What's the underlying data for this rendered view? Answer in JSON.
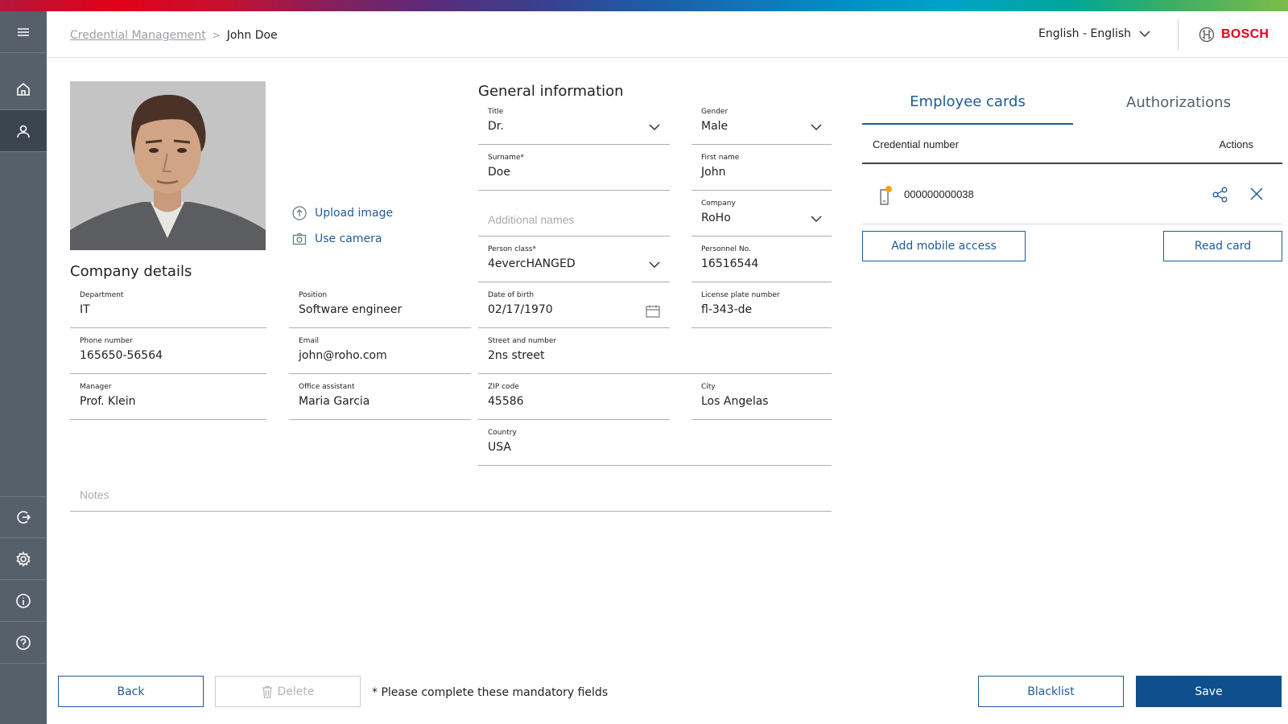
{
  "breadcrumb": {
    "parent": "Credential Management",
    "separator": ">",
    "current": "John Doe"
  },
  "header": {
    "language": "English - English",
    "brand": "BOSCH"
  },
  "photo_actions": {
    "upload": "Upload image",
    "camera": "Use camera"
  },
  "general": {
    "title": "General information",
    "fields": {
      "title": {
        "label": "Title",
        "value": "Dr."
      },
      "gender": {
        "label": "Gender",
        "value": "Male"
      },
      "surname": {
        "label": "Surname*",
        "value": "Doe"
      },
      "first_name": {
        "label": "First name",
        "value": "John"
      },
      "additional_names": {
        "placeholder": "Additional names"
      },
      "company": {
        "label": "Company",
        "value": "RoHo"
      },
      "person_class": {
        "label": "Person class*",
        "value": "4evercHANGED"
      },
      "personnel_no": {
        "label": "Personnel No.",
        "value": "16516544"
      },
      "dob": {
        "label": "Date of birth",
        "value": "02/17/1970"
      },
      "license_plate": {
        "label": "License plate number",
        "value": "fl-343-de"
      },
      "street": {
        "label": "Street and number",
        "value": "2ns street"
      },
      "zip": {
        "label": "ZIP code",
        "value": "45586"
      },
      "city": {
        "label": "City",
        "value": "Los Angelas"
      },
      "country": {
        "label": "Country",
        "value": "USA"
      }
    }
  },
  "company": {
    "title": "Company details",
    "fields": {
      "department": {
        "label": "Department",
        "value": "IT"
      },
      "position": {
        "label": "Position",
        "value": "Software engineer"
      },
      "phone": {
        "label": "Phone number",
        "value": "165650-56564"
      },
      "email": {
        "label": "Email",
        "value": "john@roho.com"
      },
      "manager": {
        "label": "Manager",
        "value": "Prof. Klein"
      },
      "office_assistant": {
        "label": "Office assistant",
        "value": "Maria Garcia"
      }
    }
  },
  "notes": {
    "placeholder": "Notes"
  },
  "tabs": {
    "employee_cards": "Employee cards",
    "authorizations": "Authorizations"
  },
  "cards_table": {
    "col_credential": "Credential number",
    "col_actions": "Actions",
    "rows": [
      {
        "number": "000000000038"
      }
    ]
  },
  "buttons": {
    "add_mobile": "Add mobile access",
    "read_card": "Read card",
    "back": "Back",
    "delete": "Delete",
    "blacklist": "Blacklist",
    "save": "Save"
  },
  "hint": "* Please complete these mandatory fields",
  "colors": {
    "brand_red": "#e2001a",
    "primary_blue": "#0f4f8f",
    "sidebar": "#55606b"
  },
  "icons": {
    "sidebar": [
      "menu-icon",
      "home-icon",
      "user-icon",
      "logout-icon",
      "settings-icon",
      "info-icon",
      "help-icon"
    ]
  }
}
